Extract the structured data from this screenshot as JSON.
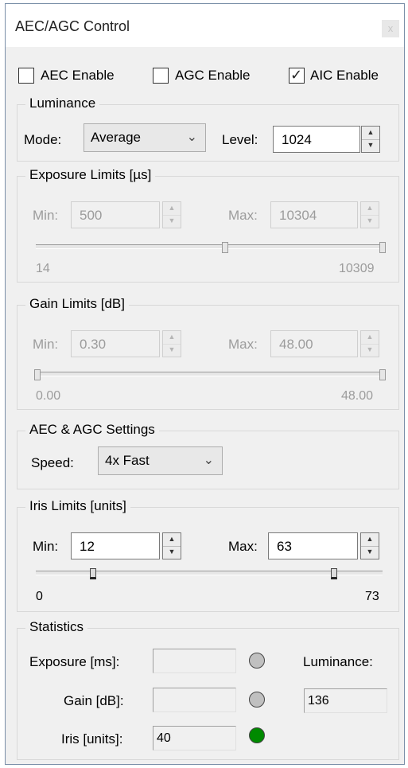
{
  "window": {
    "title": "AEC/AGC Control",
    "close_glyph": "x"
  },
  "checks": {
    "aec": {
      "label": "AEC Enable",
      "checked": false
    },
    "agc": {
      "label": "AGC Enable",
      "checked": false
    },
    "aic": {
      "label": "AIC Enable",
      "checked": true
    }
  },
  "luminance": {
    "title": "Luminance",
    "mode_label": "Mode:",
    "mode_value": "Average",
    "level_label": "Level:",
    "level_value": "1024"
  },
  "exposure": {
    "title": "Exposure Limits [µs]",
    "min_label": "Min:",
    "min_value": "500",
    "max_label": "Max:",
    "max_value": "10304",
    "range_min": "14",
    "range_max": "10309"
  },
  "gain": {
    "title": "Gain Limits [dB]",
    "min_label": "Min:",
    "min_value": "0.30",
    "max_label": "Max:",
    "max_value": "48.00",
    "range_min": "0.00",
    "range_max": "48.00"
  },
  "settings": {
    "title": "AEC & AGC Settings",
    "speed_label": "Speed:",
    "speed_value": "4x Fast"
  },
  "iris": {
    "title": "Iris Limits [units]",
    "min_label": "Min:",
    "min_value": "12",
    "max_label": "Max:",
    "max_value": "63",
    "range_min": "0",
    "range_max": "73"
  },
  "statistics": {
    "title": "Statistics",
    "exposure_label": "Exposure [ms]:",
    "exposure_value": "",
    "gain_label": "Gain [dB]:",
    "gain_value": "",
    "iris_label": "Iris [units]:",
    "iris_value": "40",
    "luminance_label": "Luminance:",
    "luminance_value": "136",
    "led_colors": {
      "exposure": "#c0c0c0",
      "gain": "#c0c0c0",
      "iris": "#008a00"
    }
  }
}
